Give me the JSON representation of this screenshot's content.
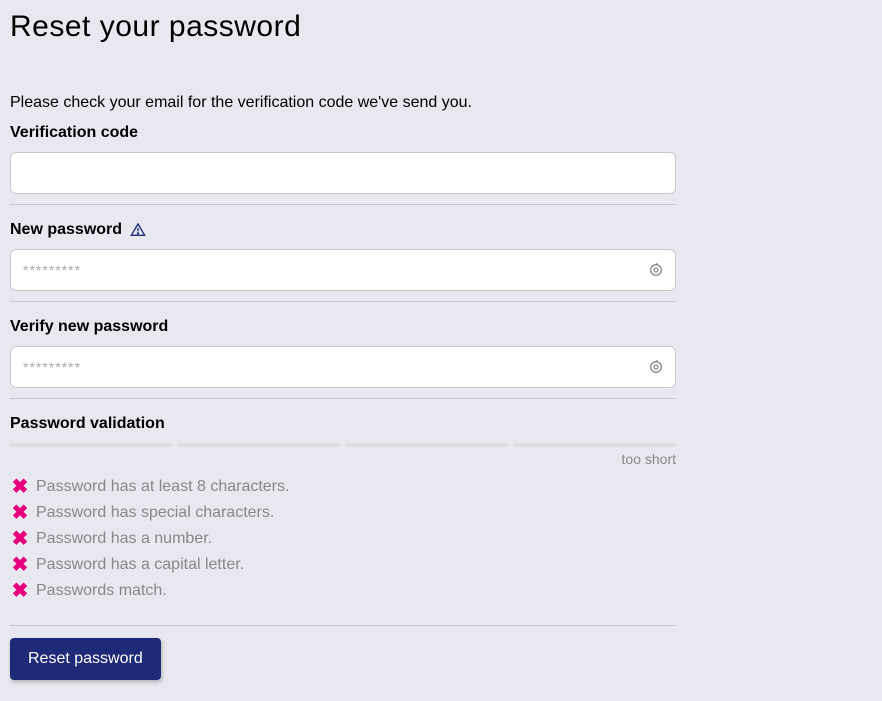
{
  "title": "Reset your password",
  "description": "Please check your email for the verification code we've send you.",
  "fields": {
    "verification": {
      "label": "Verification code",
      "value": ""
    },
    "new_password": {
      "label": "New password",
      "placeholder": "*********",
      "value": ""
    },
    "verify_password": {
      "label": "Verify new password",
      "placeholder": "*********",
      "value": ""
    }
  },
  "validation": {
    "label": "Password validation",
    "strength_text": "too short",
    "rules": [
      "Password has at least 8 characters.",
      "Password has special characters.",
      "Password has a number.",
      "Password has a capital letter.",
      "Passwords match."
    ]
  },
  "submit_label": "Reset password"
}
